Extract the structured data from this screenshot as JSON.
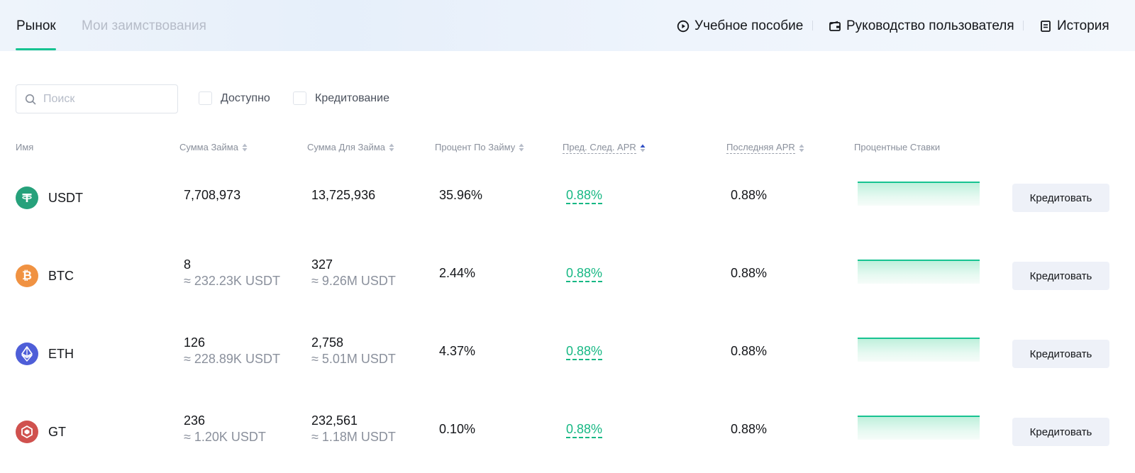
{
  "tabs": {
    "market": "Рынок",
    "my_loans": "Мои заимствования"
  },
  "links": {
    "tutorial": "Учебное пособие",
    "user_guide": "Руководство пользователя",
    "history": "История"
  },
  "filters": {
    "search_placeholder": "Поиск",
    "available": "Доступно",
    "lending": "Кредитование"
  },
  "table": {
    "headers": {
      "name": "Имя",
      "loan_amount": "Сумма Займа",
      "available_to_borrow": "Сумма Для Займа",
      "loan_rate": "Процент По Займу",
      "predicted_next_apr": "Пред. След. APR",
      "last_apr": "Последняя APR",
      "interest_rates": "Процентные Ставки"
    },
    "rows": [
      {
        "coin": "USDT",
        "icon": "tether-icon",
        "loan_amount": "7,708,973",
        "loan_amount_usdt": "",
        "available": "13,725,936",
        "available_usdt": "",
        "loan_rate": "35.96%",
        "pred_apr": "0.88%",
        "last_apr": "0.88%",
        "action": "Кредитовать"
      },
      {
        "coin": "BTC",
        "icon": "bitcoin-icon",
        "loan_amount": "8",
        "loan_amount_usdt": "≈ 232.23K USDT",
        "available": "327",
        "available_usdt": "≈ 9.26M USDT",
        "loan_rate": "2.44%",
        "pred_apr": "0.88%",
        "last_apr": "0.88%",
        "action": "Кредитовать"
      },
      {
        "coin": "ETH",
        "icon": "ethereum-icon",
        "loan_amount": "126",
        "loan_amount_usdt": "≈ 228.89K USDT",
        "available": "2,758",
        "available_usdt": "≈ 5.01M USDT",
        "loan_rate": "4.37%",
        "pred_apr": "0.88%",
        "last_apr": "0.88%",
        "action": "Кредитовать"
      },
      {
        "coin": "GT",
        "icon": "gatetoken-icon",
        "loan_amount": "236",
        "loan_amount_usdt": "≈ 1.20K USDT",
        "available": "232,561",
        "available_usdt": "≈ 1.18M USDT",
        "loan_rate": "0.10%",
        "pred_apr": "0.88%",
        "last_apr": "0.88%",
        "action": "Кредитовать"
      }
    ]
  },
  "colors": {
    "accent": "#17c391",
    "muted": "#8a909c",
    "button_bg": "#eef1f8",
    "usdt": "#26a17b",
    "btc": "#f09242",
    "eth": "#4e5ed8",
    "gt": "#d0514e"
  }
}
